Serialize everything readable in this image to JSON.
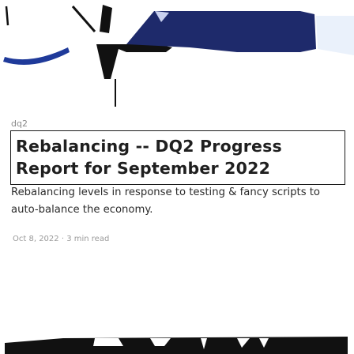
{
  "post": {
    "byline": "dq2",
    "title": "Rebalancing -- DQ2 Progress Report for September 2022",
    "description": "Rebalancing levels in response to testing & fancy scripts to auto-balance the economy.",
    "date": "Oct 8, 2022",
    "separator": "·",
    "read_time": "3 min read"
  }
}
